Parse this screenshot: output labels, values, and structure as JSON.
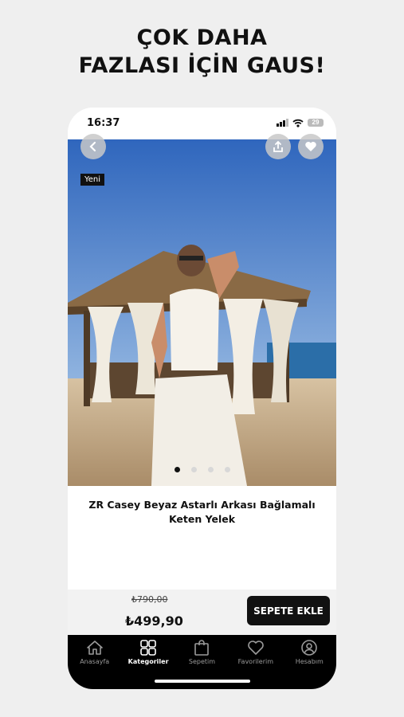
{
  "promo": {
    "line1": "ÇOK DAHA",
    "line2": "FAZLASI İÇİN GAUS!"
  },
  "status_bar": {
    "time": "16:37",
    "battery": "29"
  },
  "product": {
    "badge": "Yeni",
    "title_line1": "ZR Casey Beyaz Astarlı Arkası Bağlamalı",
    "title_line2": "Keten Yelek",
    "old_price": "₺790,00",
    "price": "₺499,90",
    "image_count": 4,
    "active_image": 0
  },
  "actions": {
    "back_icon": "chevron-left-icon",
    "share_icon": "share-icon",
    "favorite_icon": "heart-icon",
    "add_to_cart": "SEPETE EKLE"
  },
  "tabbar": {
    "items": [
      {
        "label": "Anasayfa",
        "icon": "home-icon"
      },
      {
        "label": "Kategoriler",
        "icon": "grid-icon"
      },
      {
        "label": "Sepetim",
        "icon": "bag-icon"
      },
      {
        "label": "Favorilerim",
        "icon": "heart-icon"
      },
      {
        "label": "Hesabım",
        "icon": "user-icon"
      }
    ],
    "active": "Kategoriler"
  },
  "colors": {
    "background": "#efefef",
    "accent": "#111111",
    "sky": "#3d74c4",
    "sand": "#c9b08e"
  }
}
